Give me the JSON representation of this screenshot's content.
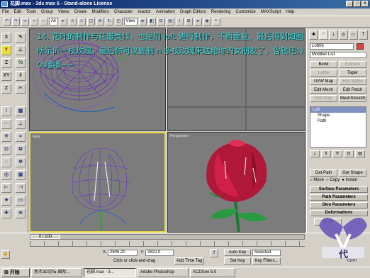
{
  "window": {
    "title": "花脚.max - 3ds max 6 - Stand-alone License"
  },
  "menu": [
    "File",
    "Edit",
    "Tools",
    "Group",
    "Views",
    "Create",
    "Modifiers",
    "Character",
    "reactor",
    "Animation",
    "Graph Editors",
    "Rendering",
    "Customize",
    "MAXScript",
    "Help"
  ],
  "toolbar": {
    "filter": "All",
    "refcoord": "View"
  },
  "left_tools": [
    "X",
    "Y",
    "Z",
    "XY",
    "Z"
  ],
  "viewports": {
    "top_left": "",
    "top_right": "",
    "bottom_left": "Rear",
    "bottom_right": "Perspective"
  },
  "overlay_text": "14. 花叶的制作与花瓣类似，也是用 loft 进行制作，不再重复。最后得到如图所示的一枝玫瑰。最后你可以复制 n 多枝玫瑰来送给你的女朋友了。省钱吧：）O.嘻嘻~~",
  "command_panel": {
    "object_name": "Loft06",
    "modifier_list": "Modifier List",
    "buttons": [
      {
        "label": "Bend",
        "enabled": true
      },
      {
        "label": "Extrude",
        "enabled": false
      },
      {
        "label": "Lathe",
        "enabled": false
      },
      {
        "label": "Taper",
        "enabled": true
      },
      {
        "label": "UVW Map",
        "enabled": true
      },
      {
        "label": "Edit Spline",
        "enabled": false
      },
      {
        "label": "Edit Mesh",
        "enabled": true
      },
      {
        "label": "Edit Patch",
        "enabled": true
      },
      {
        "label": "Edit Poly",
        "enabled": false
      },
      {
        "label": "MeshSmooth",
        "enabled": true
      }
    ],
    "stack": [
      {
        "label": "Loft",
        "selected": true
      },
      {
        "label": "Shape",
        "selected": false
      },
      {
        "label": "Path",
        "selected": false
      }
    ],
    "get_path": "Get Path",
    "get_shape": "Get Shape",
    "move": "Move",
    "copy": "Copy",
    "instance": "Instan",
    "rollouts": [
      "Surface Parameters",
      "Path Parameters",
      "Skin Parameters",
      "Deformations"
    ],
    "scale": "Scale"
  },
  "bottom": {
    "frame": "0 / 100",
    "x_value": "2805.20",
    "y_value": "3922.0",
    "prompt": "Click or click-and-drag",
    "add_time_tag": "Add Time Tag",
    "auto_key": "Auto Key",
    "selected": "Selected",
    "set_key": "Set Key",
    "key_filters": "Key Filters..."
  },
  "taskbar": {
    "start": "开始",
    "tasks": [
      {
        "label": "思杰3D论坛-国际...",
        "active": false
      },
      {
        "label": "花脚.max - 3...",
        "active": true
      },
      {
        "label": "Adobe Photoshop",
        "active": false
      },
      {
        "label": "ACDSee 5.0",
        "active": false
      }
    ]
  },
  "watermark": {
    "line1": "代",
    "line2": "com"
  }
}
